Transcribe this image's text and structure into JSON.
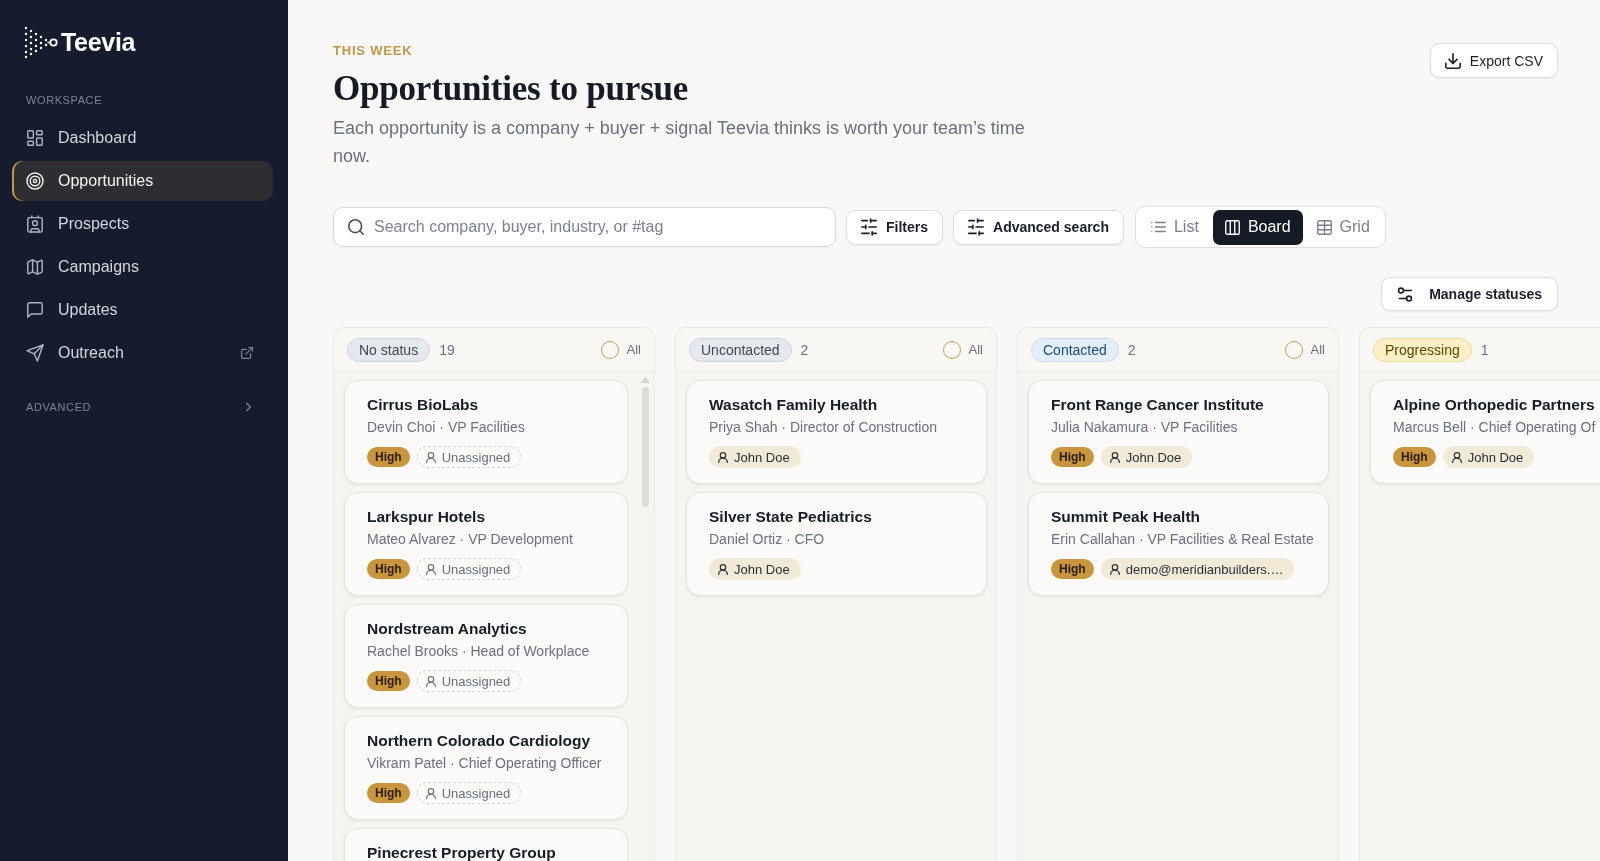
{
  "sidebar": {
    "brand": "Teevia",
    "section_label": "WORKSPACE",
    "items": [
      {
        "label": "Dashboard",
        "selected": false,
        "external": false
      },
      {
        "label": "Opportunities",
        "selected": true,
        "external": false
      },
      {
        "label": "Prospects",
        "selected": false,
        "external": false
      },
      {
        "label": "Campaigns",
        "selected": false,
        "external": false
      },
      {
        "label": "Updates",
        "selected": false,
        "external": false
      },
      {
        "label": "Outreach",
        "selected": false,
        "external": true
      }
    ],
    "advanced": {
      "label": "ADVANCED",
      "expanded": false
    }
  },
  "header": {
    "eyebrow": "THIS WEEK",
    "title": "Opportunities to pursue",
    "subtitle": "Each opportunity is a company + buyer + signal Teevia thinks is worth your team’s time now.",
    "export_button": "Export CSV"
  },
  "toolbar": {
    "search": {
      "placeholder": "Search company, buyer, industry, or #tag"
    },
    "filters_button": "Filters",
    "advanced_search_button": "Advanced search",
    "views": [
      {
        "label": "List",
        "selected": false
      },
      {
        "label": "Board",
        "selected": true
      },
      {
        "label": "Grid",
        "selected": false
      }
    ],
    "manage_statuses_button": "Manage statuses"
  },
  "board": {
    "columns": [
      {
        "status": "No status",
        "color": "#e5e8ee",
        "count": "19",
        "select_all": {
          "label": "All",
          "checked": false
        },
        "cards": [
          {
            "company": "Cirrus BioLabs",
            "buyer": "Devin Choi · VP Facilities",
            "priority": "High",
            "assignee": "Unassigned",
            "assigned": false
          },
          {
            "company": "Larkspur Hotels",
            "buyer": "Mateo Alvarez · VP Development",
            "priority": "High",
            "assignee": "Unassigned",
            "assigned": false
          },
          {
            "company": "Nordstream Analytics",
            "buyer": "Rachel Brooks · Head of Workplace",
            "priority": "High",
            "assignee": "Unassigned",
            "assigned": false
          },
          {
            "company": "Northern Colorado Cardiology",
            "buyer": "Vikram Patel · Chief Operating Officer",
            "priority": "High",
            "assignee": "Unassigned",
            "assigned": false
          },
          {
            "company": "Pinecrest Property Group"
          }
        ]
      },
      {
        "status": "Uncontacted",
        "color": "#e5e8ee",
        "count": "2",
        "select_all": {
          "label": "All",
          "checked": false
        },
        "cards": [
          {
            "company": "Wasatch Family Health",
            "buyer": "Priya Shah · Director of Construction",
            "assignee": "John Doe",
            "assigned": true
          },
          {
            "company": "Silver State Pediatrics",
            "buyer": "Daniel Ortiz · CFO",
            "assignee": "John Doe",
            "assigned": true
          }
        ]
      },
      {
        "status": "Contacted",
        "color": "#e2eefa",
        "count": "2",
        "select_all": {
          "label": "All",
          "checked": false
        },
        "cards": [
          {
            "company": "Front Range Cancer Institute",
            "buyer": "Julia Nakamura · VP Facilities",
            "priority": "High",
            "assignee": "John Doe",
            "assigned": true
          },
          {
            "company": "Summit Peak Health",
            "buyer": "Erin Callahan · VP Facilities & Real Estate",
            "priority": "High",
            "assignee": "demo@meridianbuilders.…",
            "assigned": true
          }
        ]
      },
      {
        "status": "Progressing",
        "color": "#fbf0c5",
        "count": "1",
        "cards": [
          {
            "company": "Alpine Orthopedic Partners",
            "buyer": "Marcus Bell · Chief Operating Of",
            "priority": "High",
            "assignee": "John Doe",
            "assigned": true
          }
        ]
      }
    ]
  }
}
